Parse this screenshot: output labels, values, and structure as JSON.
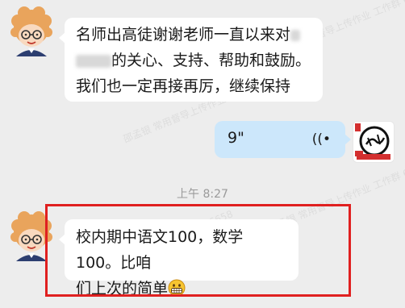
{
  "watermark": {
    "text": "邵孟银 常用督导上传作业 工作群 6658"
  },
  "messages": [
    {
      "sender": "teacher",
      "lines": [
        "名师出高徒谢谢老师一直以来对",
        "的关心、支持、帮助和鼓励。",
        "我们也一定再接再厉，继续保持"
      ]
    },
    {
      "sender": "me",
      "type": "voice",
      "duration": "9\"",
      "wave_icon": "voice-wave-icon"
    },
    {
      "sender": "teacher",
      "lines": [
        "校内期中语文100，数学100。比咱",
        "们上次的简单"
      ],
      "emoji": "grin-emoji"
    }
  ],
  "timestamp": "上午 8:27",
  "colors": {
    "highlight": "#e02020",
    "voice_bubble": "#cce7fb",
    "background": "#ededed"
  }
}
